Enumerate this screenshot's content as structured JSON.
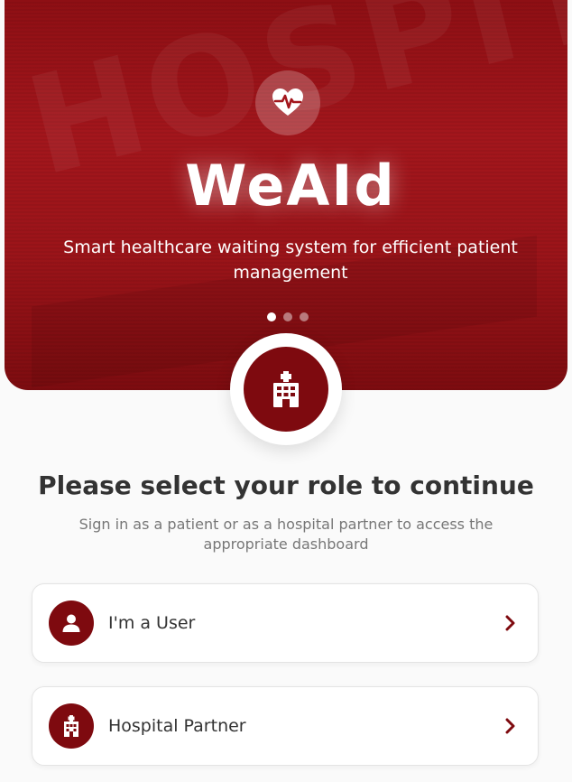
{
  "hero": {
    "brand": "WeAId",
    "tagline": "Smart healthcare waiting system for efficient patient management",
    "background_word": "HOSPITAL",
    "logo_icon": "heart-pulse-icon",
    "carousel": {
      "total": 3,
      "active": 1
    }
  },
  "badge": {
    "icon": "hospital-building-icon"
  },
  "main": {
    "heading": "Please select your role to continue",
    "subheading": "Sign in as a patient or as a hospital partner to access the appropriate dashboard"
  },
  "roles": [
    {
      "label": "I'm a User",
      "icon": "user-icon"
    },
    {
      "label": "Hospital Partner",
      "icon": "hospital-icon"
    }
  ],
  "colors": {
    "primary": "#7e0a0f",
    "hero": "#a3161c",
    "text": "#333333",
    "muted": "#777777",
    "background": "#fafafa"
  }
}
